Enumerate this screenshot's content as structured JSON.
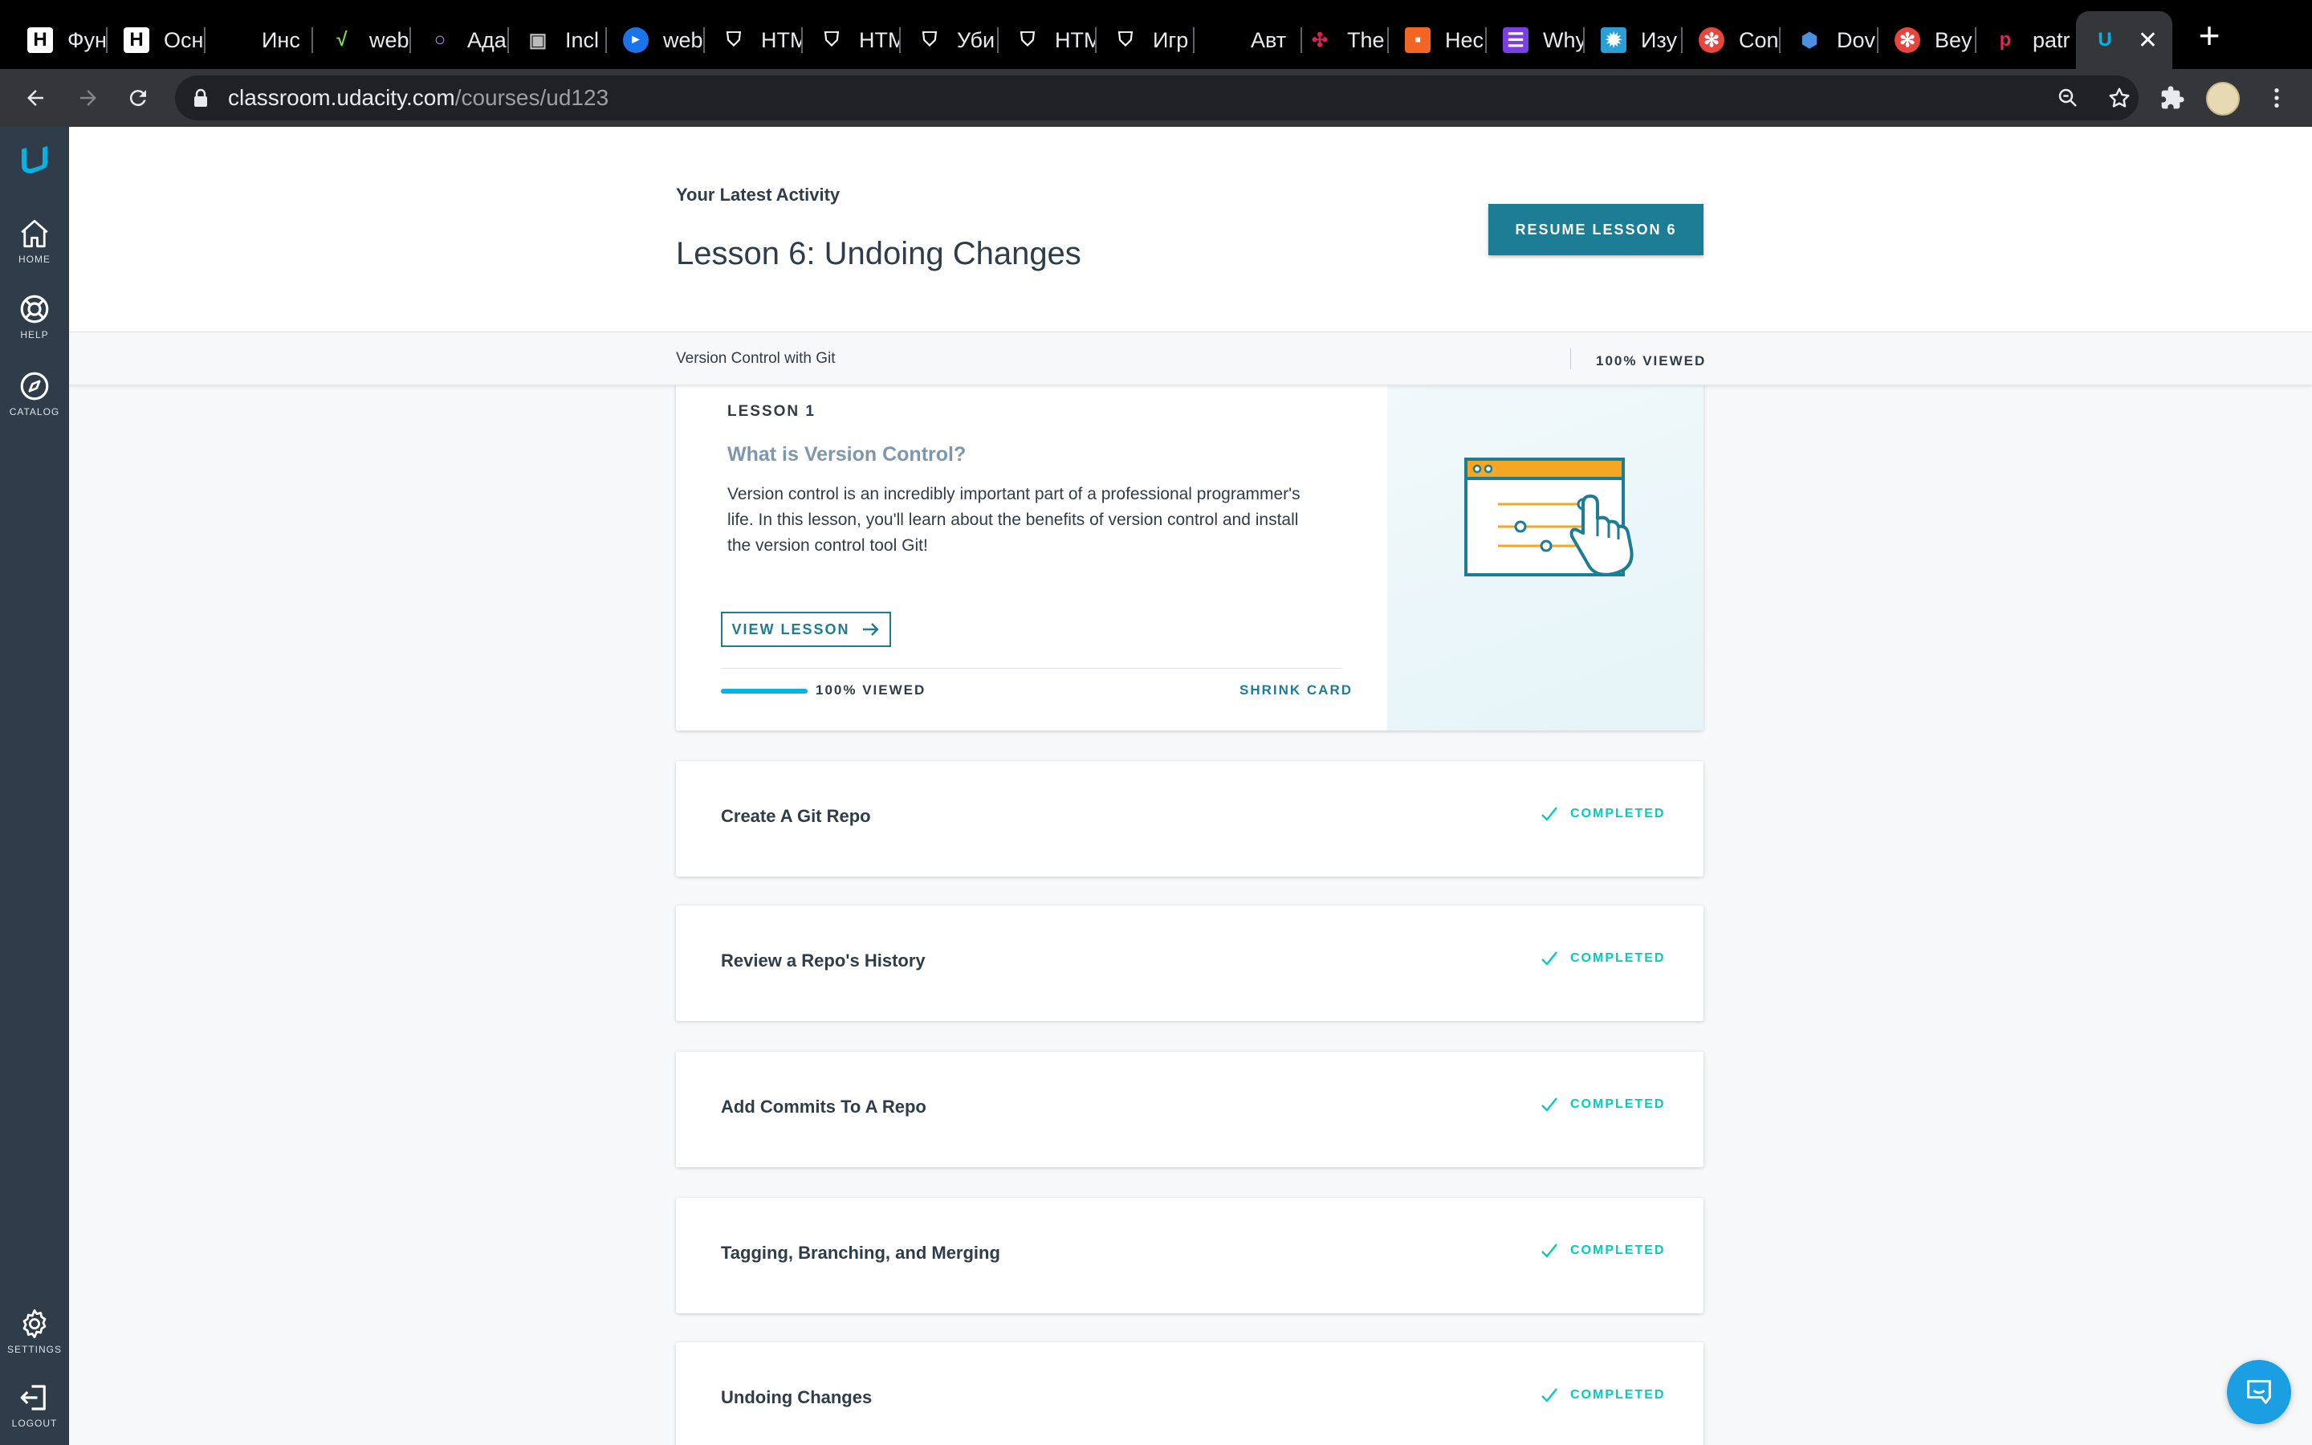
{
  "browser": {
    "tabs": [
      {
        "title": "Фун",
        "favicon": "H"
      },
      {
        "title": "Осн",
        "favicon": "H"
      },
      {
        "title": "Инс",
        "favicon": ""
      },
      {
        "title": "web",
        "favicon": "√"
      },
      {
        "title": "Ада",
        "favicon": "○"
      },
      {
        "title": "Incl",
        "favicon": "▣"
      },
      {
        "title": "web",
        "favicon": "►"
      },
      {
        "title": "HTM",
        "favicon": "⛉"
      },
      {
        "title": "HTM",
        "favicon": "⛉"
      },
      {
        "title": "Уби",
        "favicon": "⛉"
      },
      {
        "title": "HTM",
        "favicon": "⛉"
      },
      {
        "title": "Игр",
        "favicon": "⛉"
      },
      {
        "title": "Авт",
        "favicon": ""
      },
      {
        "title": "The",
        "favicon": "✣"
      },
      {
        "title": "Нес",
        "favicon": "▪"
      },
      {
        "title": "Why",
        "favicon": "☰"
      },
      {
        "title": "Изу",
        "favicon": "✹"
      },
      {
        "title": "Con",
        "favicon": "✻"
      },
      {
        "title": "Dov",
        "favicon": "⬢"
      },
      {
        "title": "Bey",
        "favicon": "✻"
      },
      {
        "title": "patr",
        "favicon": "p"
      },
      {
        "title": "",
        "favicon": "U",
        "active": true
      }
    ],
    "url_host": "classroom.udacity.com",
    "url_path": "/courses/ud123"
  },
  "sidebar": {
    "items": [
      {
        "label": "HOME",
        "icon": "home-icon"
      },
      {
        "label": "HELP",
        "icon": "lifebuoy-icon"
      },
      {
        "label": "CATALOG",
        "icon": "compass-icon"
      },
      {
        "label": "SETTINGS",
        "icon": "gear-icon"
      },
      {
        "label": "LOGOUT",
        "icon": "logout-icon"
      }
    ]
  },
  "header": {
    "latest_label": "Your Latest Activity",
    "lesson_title": "Lesson 6: Undoing Changes",
    "resume_label": "RESUME LESSON 6"
  },
  "subbar": {
    "course_name": "Version Control with Git",
    "viewed": "100% VIEWED"
  },
  "expanded_lesson": {
    "number_label": "LESSON 1",
    "title": "What is Version Control?",
    "description": "Version control is an incredibly important part of a professional programmer's life. In this lesson, you'll learn about the benefits of version control and install the version control tool Git!",
    "view_label": "VIEW LESSON",
    "progress": 1.0,
    "viewed_label": "100% VIEWED",
    "shrink_label": "SHRINK CARD"
  },
  "lessons": [
    {
      "title": "Create A Git Repo",
      "status": "COMPLETED"
    },
    {
      "title": "Review a Repo's History",
      "status": "COMPLETED"
    },
    {
      "title": "Add Commits To A Repo",
      "status": "COMPLETED"
    },
    {
      "title": "Tagging, Branching, and Merging",
      "status": "COMPLETED"
    },
    {
      "title": "Undoing Changes",
      "status": "COMPLETED"
    }
  ],
  "colors": {
    "sidebar": "#2e3d49",
    "accent": "#1c7d95",
    "completed": "#02ccba",
    "progress": "#02b3e4"
  }
}
